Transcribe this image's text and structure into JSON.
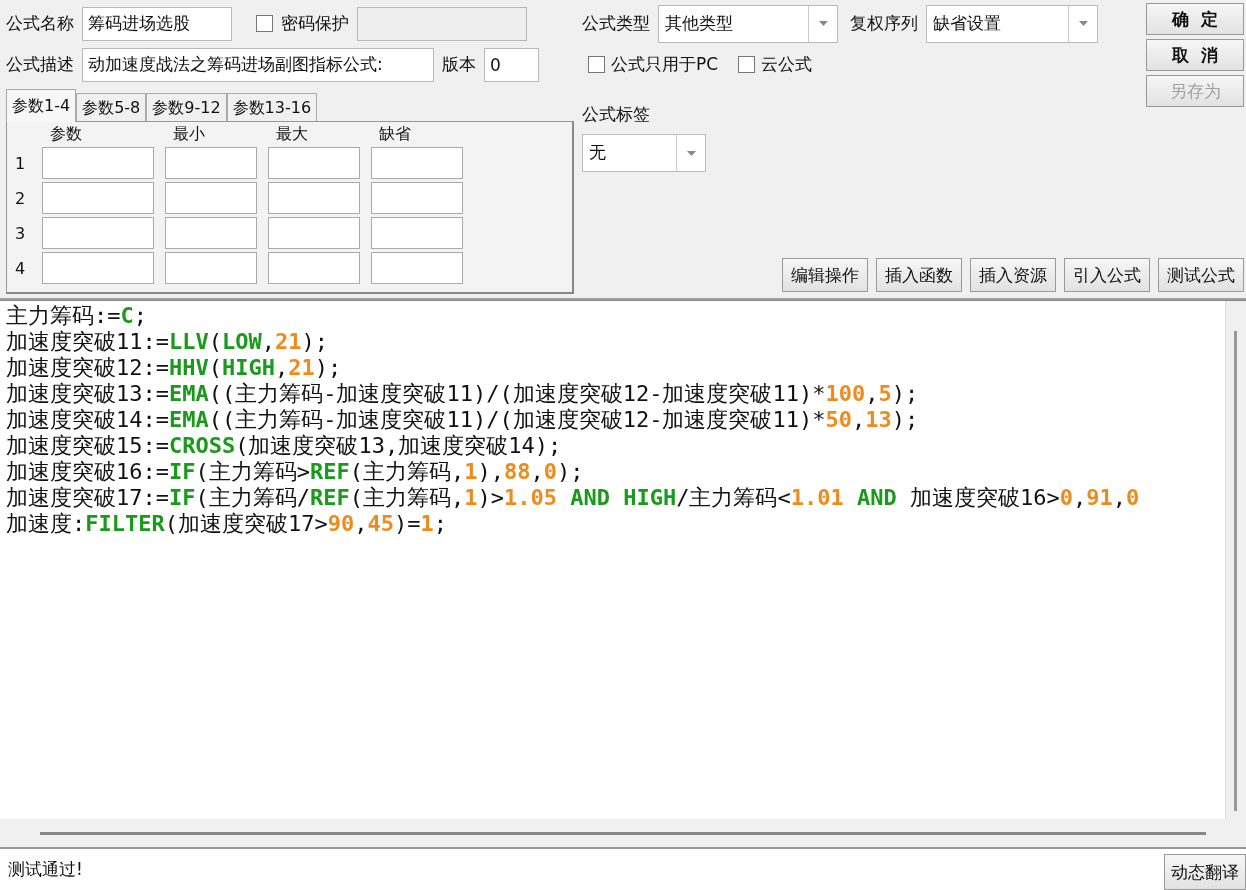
{
  "formula_name": {
    "label": "公式名称",
    "value": "筹码进场选股"
  },
  "password": {
    "label": "密码保护",
    "checked": false
  },
  "description": {
    "label": "公式描述",
    "value": "动加速度战法之筹码进场副图指标公式:"
  },
  "version": {
    "label": "版本",
    "value": "0"
  },
  "tabs": [
    {
      "label": "参数1-4",
      "selected": true
    },
    {
      "label": "参数5-8",
      "selected": false
    },
    {
      "label": "参数9-12",
      "selected": false
    },
    {
      "label": "参数13-16",
      "selected": false
    }
  ],
  "params": {
    "columns": [
      "参数",
      "最小",
      "最大",
      "缺省"
    ],
    "rows": [
      {
        "number": "1"
      },
      {
        "number": "2"
      },
      {
        "number": "3"
      },
      {
        "number": "4"
      }
    ]
  },
  "formula_type": {
    "label": "公式类型",
    "value": "其他类型"
  },
  "adjust_series": {
    "label": "复权序列",
    "value": "缺省设置"
  },
  "options": [
    {
      "label": "公式只用于PC",
      "checked": false
    },
    {
      "label": "云公式",
      "checked": false
    }
  ],
  "formula_tag": {
    "label": "公式标签",
    "value": "无"
  },
  "side_buttons": [
    {
      "label": "确  定",
      "disabled": false
    },
    {
      "label": "取  消",
      "disabled": false
    },
    {
      "label": "另存为",
      "disabled": true
    }
  ],
  "tool_buttons": [
    {
      "label": "编辑操作"
    },
    {
      "label": "插入函数"
    },
    {
      "label": "插入资源"
    },
    {
      "label": "引入公式"
    },
    {
      "label": "测试公式"
    }
  ],
  "code_lines": [
    [
      {
        "kind": "plain",
        "text": "主力筹码:="
      },
      {
        "kind": "func",
        "text": "C"
      },
      {
        "kind": "plain",
        "text": ";"
      }
    ],
    [
      {
        "kind": "plain",
        "text": "加速度突破11:="
      },
      {
        "kind": "func",
        "text": "LLV"
      },
      {
        "kind": "plain",
        "text": "("
      },
      {
        "kind": "func",
        "text": "LOW"
      },
      {
        "kind": "plain",
        "text": ","
      },
      {
        "kind": "num",
        "text": "21"
      },
      {
        "kind": "plain",
        "text": ");"
      }
    ],
    [
      {
        "kind": "plain",
        "text": "加速度突破12:="
      },
      {
        "kind": "func",
        "text": "HHV"
      },
      {
        "kind": "plain",
        "text": "("
      },
      {
        "kind": "func",
        "text": "HIGH"
      },
      {
        "kind": "plain",
        "text": ","
      },
      {
        "kind": "num",
        "text": "21"
      },
      {
        "kind": "plain",
        "text": ");"
      }
    ],
    [
      {
        "kind": "plain",
        "text": "加速度突破13:="
      },
      {
        "kind": "func",
        "text": "EMA"
      },
      {
        "kind": "plain",
        "text": "((主力筹码-加速度突破11)/(加速度突破12-加速度突破11)*"
      },
      {
        "kind": "num",
        "text": "100"
      },
      {
        "kind": "plain",
        "text": ","
      },
      {
        "kind": "num",
        "text": "5"
      },
      {
        "kind": "plain",
        "text": ");"
      }
    ],
    [
      {
        "kind": "plain",
        "text": "加速度突破14:="
      },
      {
        "kind": "func",
        "text": "EMA"
      },
      {
        "kind": "plain",
        "text": "((主力筹码-加速度突破11)/(加速度突破12-加速度突破11)*"
      },
      {
        "kind": "num",
        "text": "50"
      },
      {
        "kind": "plain",
        "text": ","
      },
      {
        "kind": "num",
        "text": "13"
      },
      {
        "kind": "plain",
        "text": ");"
      }
    ],
    [
      {
        "kind": "plain",
        "text": "加速度突破15:="
      },
      {
        "kind": "func",
        "text": "CROSS"
      },
      {
        "kind": "plain",
        "text": "(加速度突破13,加速度突破14);"
      }
    ],
    [
      {
        "kind": "plain",
        "text": "加速度突破16:="
      },
      {
        "kind": "func",
        "text": "IF"
      },
      {
        "kind": "plain",
        "text": "(主力筹码>"
      },
      {
        "kind": "func",
        "text": "REF"
      },
      {
        "kind": "plain",
        "text": "(主力筹码,"
      },
      {
        "kind": "num",
        "text": "1"
      },
      {
        "kind": "plain",
        "text": "),"
      },
      {
        "kind": "num",
        "text": "88"
      },
      {
        "kind": "plain",
        "text": ","
      },
      {
        "kind": "num",
        "text": "0"
      },
      {
        "kind": "plain",
        "text": ");"
      }
    ],
    [
      {
        "kind": "plain",
        "text": "加速度突破17:="
      },
      {
        "kind": "func",
        "text": "IF"
      },
      {
        "kind": "plain",
        "text": "(主力筹码/"
      },
      {
        "kind": "func",
        "text": "REF"
      },
      {
        "kind": "plain",
        "text": "(主力筹码,"
      },
      {
        "kind": "num",
        "text": "1"
      },
      {
        "kind": "plain",
        "text": ")>"
      },
      {
        "kind": "num",
        "text": "1.05"
      },
      {
        "kind": "func",
        "text": " AND HIGH"
      },
      {
        "kind": "plain",
        "text": "/主力筹码<"
      },
      {
        "kind": "num",
        "text": "1.01"
      },
      {
        "kind": "func",
        "text": " AND"
      },
      {
        "kind": "plain",
        "text": " 加速度突破16>"
      },
      {
        "kind": "num",
        "text": "0"
      },
      {
        "kind": "plain",
        "text": ","
      },
      {
        "kind": "num",
        "text": "91"
      },
      {
        "kind": "plain",
        "text": ","
      },
      {
        "kind": "num",
        "text": "0"
      }
    ],
    [
      {
        "kind": "plain",
        "text": "加速度:"
      },
      {
        "kind": "func",
        "text": "FILTER"
      },
      {
        "kind": "plain",
        "text": "(加速度突破17>"
      },
      {
        "kind": "num",
        "text": "90"
      },
      {
        "kind": "plain",
        "text": ","
      },
      {
        "kind": "num",
        "text": "45"
      },
      {
        "kind": "plain",
        "text": ")="
      },
      {
        "kind": "num",
        "text": "1"
      },
      {
        "kind": "plain",
        "text": ";"
      }
    ]
  ],
  "status": {
    "message": "测试通过!",
    "button": "动态翻译"
  }
}
